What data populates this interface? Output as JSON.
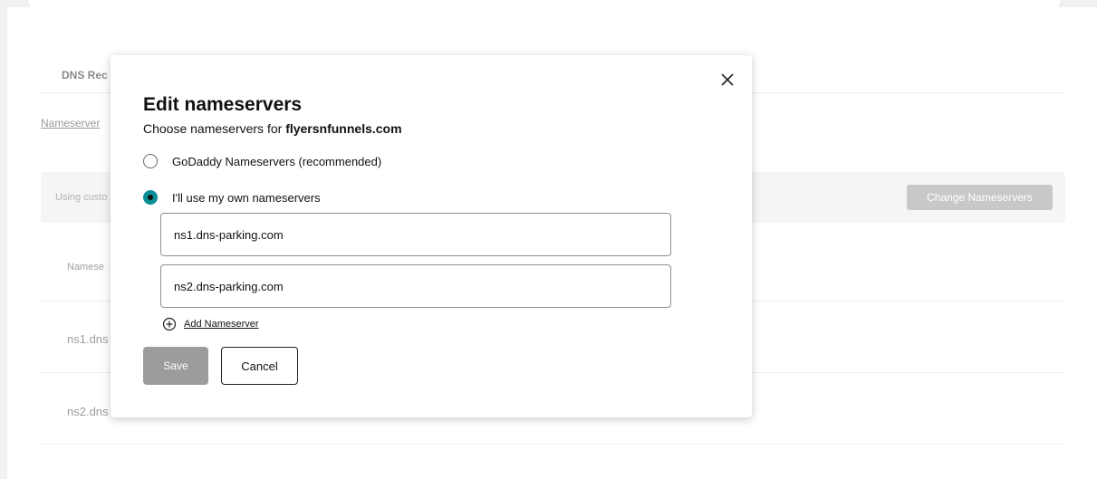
{
  "background": {
    "tab_label": "DNS Rec",
    "link_label": "Nameserver",
    "banner_text": "Using custo",
    "change_button": "Change Nameservers",
    "column_header": "Namese",
    "rows": [
      "ns1.dns",
      "ns2.dns"
    ]
  },
  "modal": {
    "title": "Edit nameservers",
    "subtitle_prefix": "Choose nameservers for ",
    "domain": "flyersnfunnels.com",
    "options": [
      {
        "label": "GoDaddy Nameservers (recommended)",
        "selected": false
      },
      {
        "label": "I'll use my own nameservers",
        "selected": true
      }
    ],
    "nameservers": [
      "ns1.dns-parking.com",
      "ns2.dns-parking.com"
    ],
    "add_label": "Add Nameserver",
    "save_label": "Save",
    "cancel_label": "Cancel"
  },
  "icons": {
    "close": "close-icon",
    "add": "plus-circle-icon"
  },
  "colors": {
    "accent": "#0a8f97",
    "save_disabled": "#9c9c9c",
    "change_disabled": "#c8c8c8"
  }
}
